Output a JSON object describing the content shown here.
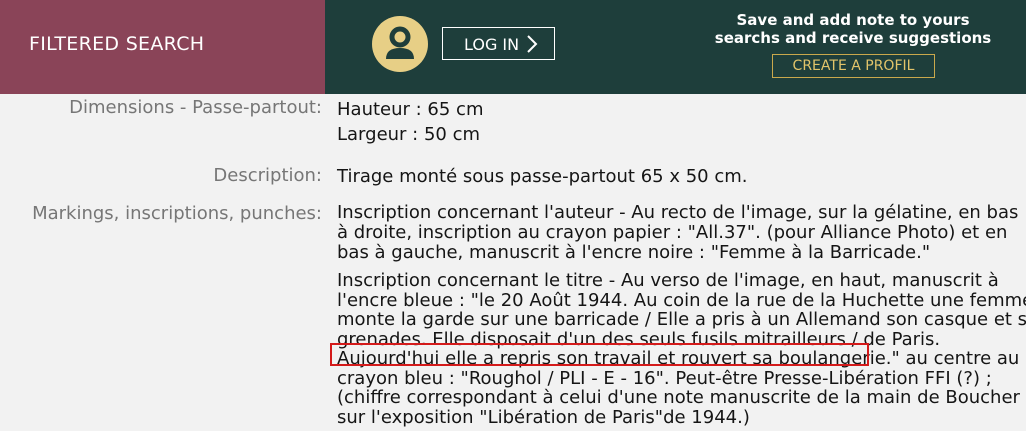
{
  "header": {
    "filtered_search": "FILTERED SEARCH",
    "login": "LOG IN",
    "promo": "Save and add note to yours searchs and receive suggestions",
    "create_profile": "CREATE A PROFIL"
  },
  "details": {
    "dimensions_label": "Dimensions - Passe-partout:",
    "height": "Hauteur : 65 cm",
    "width": "Largeur : 50 cm",
    "description_label": "Description:",
    "description": "Tirage monté sous passe-partout 65 x 50 cm.",
    "markings_label": "Markings, inscriptions, punches:",
    "author_inscription": "Inscription concernant l'auteur - Au recto de l'image, sur la gélatine, en bas à droite, inscription au crayon papier : \"All.37\". (pour Alliance Photo) et en bas à gauche, manuscrit à l'encre noire : \"Femme à la Barricade.\"",
    "title_lines": [
      "Inscription concernant le titre - Au verso de l'image, en haut, manuscrit à",
      "l'encre bleue : \"le 20 Août 1944. Au coin de la rue de la Huchette une femme",
      "monte la garde sur une barricade / Elle a pris à un Allemand son casque et ses",
      "grenades. Elle disposait d'un des seuls fusils mitrailleurs / de Paris.",
      "Aujourd'hui elle a repris son travail et rouvert sa boulangerie.\" au centre au",
      "crayon bleu : \"Roughol / PLI - E - 16\". Peut-être Presse-Libération FFI (?) ;",
      "(chiffre correspondant à celui d'une note manuscrite de la main de Boucher (?)",
      "sur l'exposition \"Libération de Paris\"de 1944.)"
    ]
  }
}
